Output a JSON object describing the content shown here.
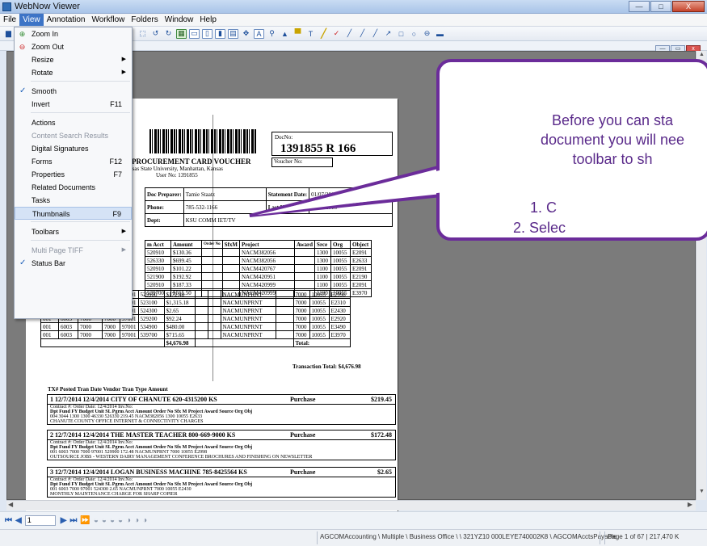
{
  "window": {
    "title": "WebNow Viewer",
    "min": "—",
    "max": "□",
    "close": "X"
  },
  "menubar": [
    "File",
    "View",
    "Annotation",
    "Workflow",
    "Folders",
    "Window",
    "Help"
  ],
  "view_menu": {
    "zoom_in": "Zoom In",
    "zoom_out": "Zoom Out",
    "resize": "Resize",
    "rotate": "Rotate",
    "smooth": "Smooth",
    "invert": "Invert",
    "invert_sc": "F11",
    "actions": "Actions",
    "content_search": "Content Search Results",
    "digital_signatures": "Digital Signatures",
    "forms": "Forms",
    "forms_sc": "F12",
    "properties": "Properties",
    "properties_sc": "F7",
    "related": "Related Documents",
    "tasks": "Tasks",
    "thumbnails": "Thumbnails",
    "thumbnails_sc": "F9",
    "toolbars": "Toolbars",
    "multipage": "Multi Page TIFF",
    "statusbar": "Status Bar"
  },
  "document": {
    "docno_label": "DocNo:",
    "docno": "1391855 R 166",
    "voucher_label": "Voucher No:",
    "title": "PROCUREMENT CARD VOUCHER",
    "subtitle": "Kansas State University, Manhattan, Kansas",
    "user": "User No: 1391855",
    "doc_preparer_label": "Doc Preparer:",
    "doc_preparer": "Tamie Staatz",
    "statement_label": "Statement Date:",
    "statement_date": "01/07/2015",
    "phone_label": "Phone:",
    "phone": "785-532-1166",
    "last_update_label": "Last Update:",
    "last_update": "01/21/2015",
    "dept_label": "Dept:",
    "dept": "KSU COMM IET/TV",
    "table_headers": [
      "m Acct",
      "Amount",
      "Order No",
      "SfxM",
      "Project",
      "Award",
      "Srce",
      "Org",
      "Object"
    ],
    "rows": [
      [
        "520910",
        "$130.36",
        "",
        "",
        "NACM382056",
        "",
        "1300",
        "10055",
        "E2091"
      ],
      [
        "526330",
        "$699.45",
        "",
        "",
        "NACM382056",
        "",
        "1300",
        "10055",
        "E2633"
      ],
      [
        "520910",
        "$101.22",
        "",
        "",
        "NACM420767",
        "",
        "1100",
        "10055",
        "E2091"
      ],
      [
        "521900",
        "$192.92",
        "",
        "",
        "NACM420951",
        "",
        "1100",
        "10055",
        "E2190"
      ],
      [
        "520910",
        "$187.33",
        "",
        "",
        "NACM420999",
        "",
        "1100",
        "10055",
        "E2091"
      ],
      [
        "539700",
        "$565.50",
        "",
        "",
        "NACM420999",
        "",
        "1100",
        "10055",
        "E3970"
      ]
    ],
    "rows2": [
      [
        "001",
        "6003",
        "7000",
        "7000",
        "97001",
        "529900",
        "$172.48",
        "NACMUNPRNT",
        "7000",
        "10055",
        "E2998"
      ],
      [
        "001",
        "6003",
        "7000",
        "7000",
        "97001",
        "523100",
        "$1,315.18",
        "NACMUNPRNT",
        "7000",
        "10055",
        "E2310"
      ],
      [
        "001",
        "6003",
        "7000",
        "7000",
        "97001",
        "524300",
        "$2.65",
        "NACMUNPRNT",
        "7000",
        "10055",
        "E2430"
      ],
      [
        "001",
        "6003",
        "7000",
        "7000",
        "97001",
        "529200",
        "$92.24",
        "NACMUNPRNT",
        "7000",
        "10055",
        "E2920"
      ],
      [
        "001",
        "6003",
        "7000",
        "7000",
        "97001",
        "534900",
        "$480.00",
        "NACMUNPRNT",
        "7000",
        "10055",
        "E3490"
      ],
      [
        "001",
        "6003",
        "7000",
        "7000",
        "97001",
        "539700",
        "$715.65",
        "NACMUNPRNT",
        "7000",
        "10055",
        "E3970"
      ]
    ],
    "table_total": "$4,676.98",
    "total_label": "Total:",
    "transaction_total": "Transaction Total: $4,676.98",
    "tx_header": "TX#  Posted    Tran Date                                  Vendor                                       Tran Type            Amount",
    "tx": [
      {
        "r1": "1   12/7/2014   12/4/2014  CITY OF CHANUTE  620-4315200 KS",
        "type": "Purchase",
        "amt": "$219.45",
        "r2": "Contract #:            Order Date: 12/4/2014     Inv.No:",
        "r3": "Dpt  Fund  FY   Budget Unit   SL  Pgrm   Acct    Amount  Order No  Sfx  M    Project     Award  Source  Org   Obj",
        "r4": "004  3044         1300    1300  46330  526330    219.45                     NACM382056        1300   10055  E2633",
        "desc": "CHANUTE COUNTY OFFICE INTERNET & CONNECTIVITY CHARGES"
      },
      {
        "r1": "2   12/7/2014   12/4/2014  THE MASTER TEACHER  800-669-9000 KS",
        "type": "Purchase",
        "amt": "$172.48",
        "r2": "Contract #:            Order Date: 12/4/2014     Inv.No:",
        "r3": "Dpt  Fund  FY   Budget Unit   SL  Pgrm   Acct    Amount  Order No  Sfx  M    Project     Award  Source  Org   Obj",
        "r4": "001  6003         7000    7000  97001  529900    172.48                     NACMUNPRNT        7000   10055  E2998",
        "desc": "OUTSOURCE JOBS - WESTERN DAIRY MANAGEMENT CONFERENCE BROCHURES AND FINISHING ON NEWSLETTER"
      },
      {
        "r1": "3   12/7/2014   12/4/2014  LOGAN BUSINESS MACHINE  785-8425564 KS",
        "type": "Purchase",
        "amt": "$2.65",
        "r2": "Contract #:            Order Date: 12/4/2014     Inv.No:",
        "r3": "Dpt  Fund  FY   Budget Unit   SL  Pgrm   Acct    Amount  Order No  Sfx  M    Project     Award  Source  Org   Obj",
        "r4": "001  6003         7000    97001  524300      2.65                     NACMUNPRNT        7000   10055  E2430",
        "desc": "MONTHLY MAINTENANCE CHARGE FOR SHARP COPIER"
      }
    ]
  },
  "callout": {
    "line1": "Before you can sta",
    "line2": "document you will nee",
    "line3": "toolbar to sh",
    "item1": "1.  C",
    "item2": "2.  Selec"
  },
  "navbar": {
    "page_input": "1"
  },
  "status": {
    "path": "AGCOMAccounting \\ Multiple \\ Business Office \\ \\ 321YZ10  000LEYE740002K8 \\ AGCOMAcctsPayable",
    "page": "Page 1 of 67  |  217,470 K"
  },
  "colors": {
    "callout_border": "#6b2c9a",
    "callout_text": "#5a2a8a",
    "menu_highlight": "#3d74c6"
  }
}
